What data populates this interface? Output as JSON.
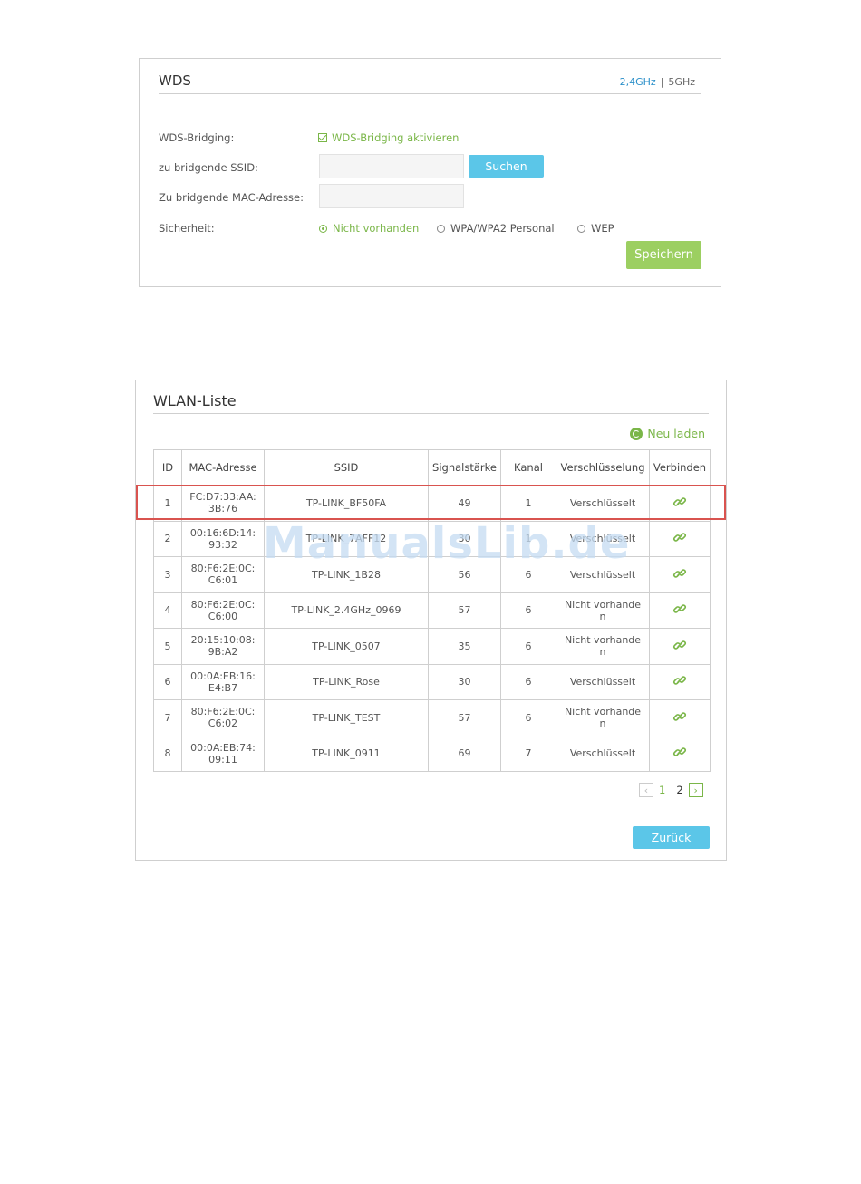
{
  "wds": {
    "title": "WDS",
    "bands": {
      "band1": "2,4GHz",
      "separator": "|",
      "band2": "5GHz"
    },
    "bridging_label": "WDS-Bridging:",
    "bridging_checkbox_label": "WDS-Bridging aktivieren",
    "bridging_checked": true,
    "ssid_label": "zu bridgende SSID:",
    "ssid_value": "",
    "search_button": "Suchen",
    "mac_label": "Zu bridgende MAC-Adresse:",
    "mac_value": "",
    "security_label": "Sicherheit:",
    "security_options": [
      "Nicht vorhanden",
      "WPA/WPA2 Personal",
      "WEP"
    ],
    "security_selected": "Nicht vorhanden",
    "save_button": "Speichern"
  },
  "wlan": {
    "title": "WLAN-Liste",
    "reload": "Neu laden",
    "columns": [
      "ID",
      "MAC-Adresse",
      "SSID",
      "Signalstärke",
      "Kanal",
      "Verschlüsselung",
      "Verbinden"
    ],
    "rows": [
      {
        "id": "1",
        "mac1": "FC:D7:33:AA:",
        "mac2": "3B:76",
        "ssid": "TP-LINK_BF50FA",
        "signal": "49",
        "channel": "1",
        "enc1": "Verschlüsselt",
        "enc2": ""
      },
      {
        "id": "2",
        "mac1": "00:16:6D:14:",
        "mac2": "93:32",
        "ssid": "TP-LINK_7AFF12",
        "signal": "30",
        "channel": "1",
        "enc1": "Verschlüsselt",
        "enc2": ""
      },
      {
        "id": "3",
        "mac1": "80:F6:2E:0C:",
        "mac2": "C6:01",
        "ssid": "TP-LINK_1B28",
        "signal": "56",
        "channel": "6",
        "enc1": "Verschlüsselt",
        "enc2": ""
      },
      {
        "id": "4",
        "mac1": "80:F6:2E:0C:",
        "mac2": "C6:00",
        "ssid": "TP-LINK_2.4GHz_0969",
        "signal": "57",
        "channel": "6",
        "enc1": "Nicht vorhande",
        "enc2": "n"
      },
      {
        "id": "5",
        "mac1": "20:15:10:08:",
        "mac2": "9B:A2",
        "ssid": "TP-LINK_0507",
        "signal": "35",
        "channel": "6",
        "enc1": "Nicht vorhande",
        "enc2": "n"
      },
      {
        "id": "6",
        "mac1": "00:0A:EB:16:",
        "mac2": "E4:B7",
        "ssid": "TP-LINK_Rose",
        "signal": "30",
        "channel": "6",
        "enc1": "Verschlüsselt",
        "enc2": ""
      },
      {
        "id": "7",
        "mac1": "80:F6:2E:0C:",
        "mac2": "C6:02",
        "ssid": "TP-LINK_TEST",
        "signal": "57",
        "channel": "6",
        "enc1": "Nicht vorhande",
        "enc2": "n"
      },
      {
        "id": "8",
        "mac1": "00:0A:EB:74:",
        "mac2": "09:11",
        "ssid": "TP-LINK_0911",
        "signal": "69",
        "channel": "7",
        "enc1": "Verschlüsselt",
        "enc2": ""
      }
    ],
    "pager": {
      "prev": "‹",
      "page1": "1",
      "page2": "2",
      "next": "›"
    },
    "back_button": "Zurück"
  },
  "watermark": "ManualsLib.de",
  "colors": {
    "accent_green": "#7ab648",
    "button_blue": "#5bc6e8",
    "save_green": "#9ccf61",
    "highlight_red": "#d9534f"
  }
}
